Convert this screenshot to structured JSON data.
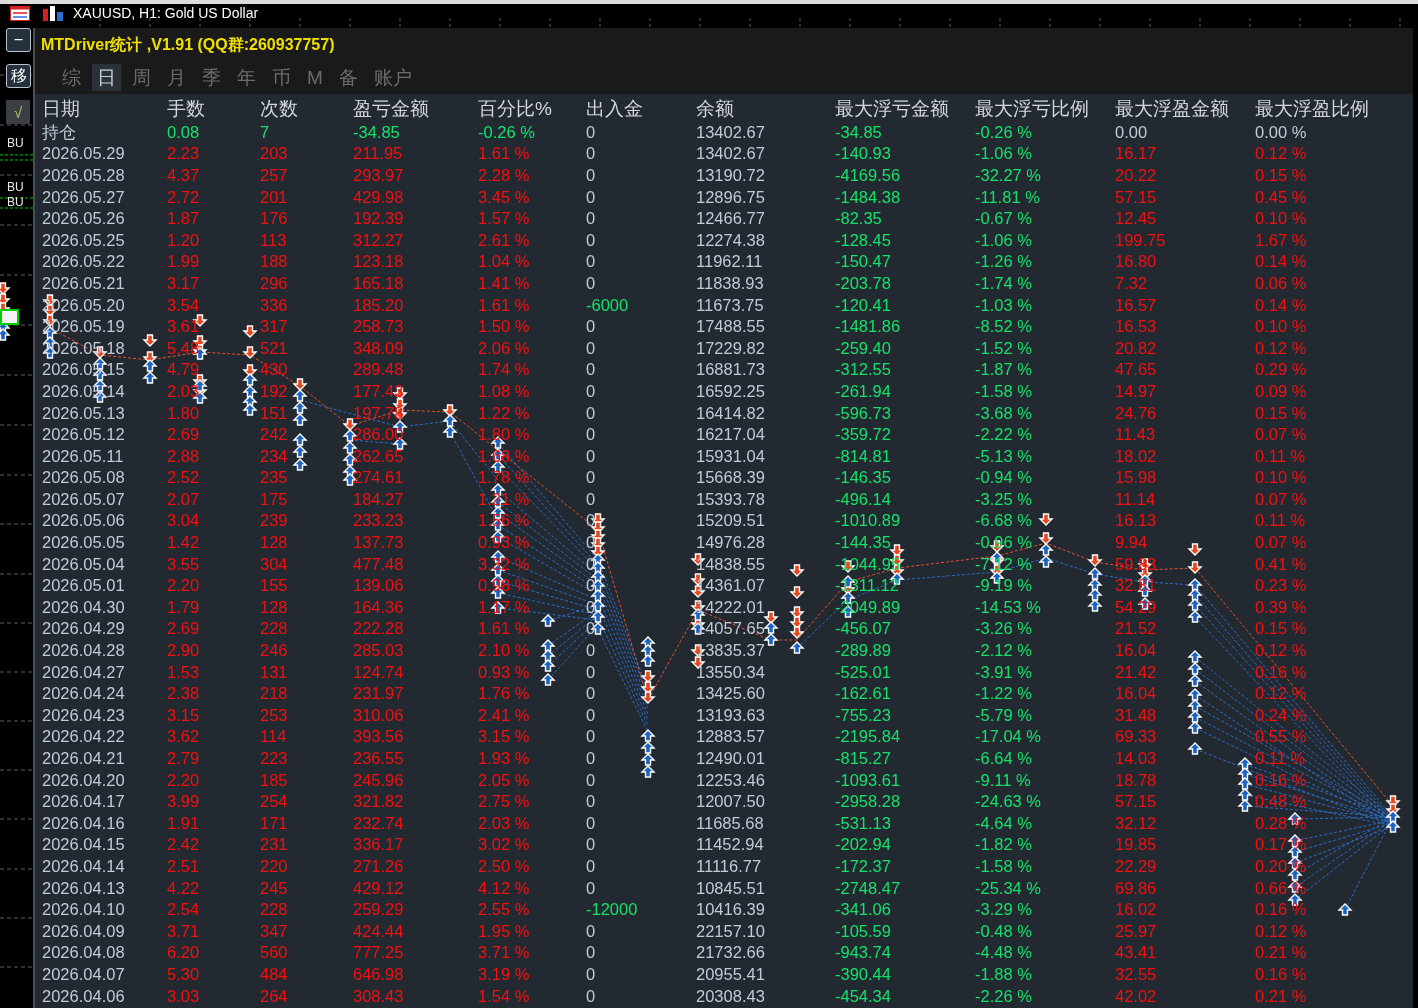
{
  "chart": {
    "title": "XAUUSD, H1: Gold US Dollar",
    "side_buttons": [
      {
        "label": "−",
        "kind": "boxed"
      },
      {
        "label": "移",
        "kind": "boxed"
      },
      {
        "label": "√",
        "kind": "solid"
      }
    ],
    "order_labels": [
      "BU",
      "BU",
      "BU"
    ]
  },
  "panel": {
    "title": "MTDriver统计 ,V1.91 (QQ群:260937757)",
    "tabs": [
      {
        "label": "综",
        "selected": false
      },
      {
        "label": "日",
        "selected": true
      },
      {
        "label": "周",
        "selected": false
      },
      {
        "label": "月",
        "selected": false
      },
      {
        "label": "季",
        "selected": false
      },
      {
        "label": "年",
        "selected": false
      },
      {
        "label": "币",
        "selected": false
      },
      {
        "label": "M",
        "selected": false
      },
      {
        "label": "备",
        "selected": false
      },
      {
        "label": "账户",
        "selected": false
      }
    ]
  },
  "table": {
    "columns": [
      "日期",
      "手数",
      "次数",
      "盈亏金额",
      "百分比%",
      "出入金",
      "余额",
      "最大浮亏金额",
      "最大浮亏比例",
      "最大浮盈金额",
      "最大浮盈比例"
    ],
    "rows": [
      {
        "date": "持仓",
        "lots": "0.08",
        "trades": "7",
        "pnl": "-34.85",
        "pnl_pct": "-0.26 %",
        "transfer": "0",
        "balance": "13402.67",
        "max_float_loss": "-34.85",
        "max_float_loss_pct": "-0.26 %",
        "max_float_profit": "0.00",
        "max_float_profit_pct": "0.00 %",
        "in_profit": false,
        "transfer_negative": false,
        "float_profit_positive": false
      },
      {
        "date": "2026.05.29",
        "lots": "2.23",
        "trades": "203",
        "pnl": "211.95",
        "pnl_pct": "1.61 %",
        "transfer": "0",
        "balance": "13402.67",
        "max_float_loss": "-140.93",
        "max_float_loss_pct": "-1.06 %",
        "max_float_profit": "16.17",
        "max_float_profit_pct": "0.12 %",
        "in_profit": true,
        "transfer_negative": false,
        "float_profit_positive": true
      },
      {
        "date": "2026.05.28",
        "lots": "4.37",
        "trades": "257",
        "pnl": "293.97",
        "pnl_pct": "2.28 %",
        "transfer": "0",
        "balance": "13190.72",
        "max_float_loss": "-4169.56",
        "max_float_loss_pct": "-32.27 %",
        "max_float_profit": "20.22",
        "max_float_profit_pct": "0.15 %",
        "in_profit": true,
        "transfer_negative": false,
        "float_profit_positive": true
      },
      {
        "date": "2026.05.27",
        "lots": "2.72",
        "trades": "201",
        "pnl": "429.98",
        "pnl_pct": "3.45 %",
        "transfer": "0",
        "balance": "12896.75",
        "max_float_loss": "-1484.38",
        "max_float_loss_pct": "-11.81 %",
        "max_float_profit": "57.15",
        "max_float_profit_pct": "0.45 %",
        "in_profit": true,
        "transfer_negative": false,
        "float_profit_positive": true
      },
      {
        "date": "2026.05.26",
        "lots": "1.87",
        "trades": "176",
        "pnl": "192.39",
        "pnl_pct": "1.57 %",
        "transfer": "0",
        "balance": "12466.77",
        "max_float_loss": "-82.35",
        "max_float_loss_pct": "-0.67 %",
        "max_float_profit": "12.45",
        "max_float_profit_pct": "0.10 %",
        "in_profit": true,
        "transfer_negative": false,
        "float_profit_positive": true
      },
      {
        "date": "2026.05.25",
        "lots": "1.20",
        "trades": "113",
        "pnl": "312.27",
        "pnl_pct": "2.61 %",
        "transfer": "0",
        "balance": "12274.38",
        "max_float_loss": "-128.45",
        "max_float_loss_pct": "-1.06 %",
        "max_float_profit": "199.75",
        "max_float_profit_pct": "1.67 %",
        "in_profit": true,
        "transfer_negative": false,
        "float_profit_positive": true
      },
      {
        "date": "2026.05.22",
        "lots": "1.99",
        "trades": "188",
        "pnl": "123.18",
        "pnl_pct": "1.04 %",
        "transfer": "0",
        "balance": "11962.11",
        "max_float_loss": "-150.47",
        "max_float_loss_pct": "-1.26 %",
        "max_float_profit": "16.80",
        "max_float_profit_pct": "0.14 %",
        "in_profit": true,
        "transfer_negative": false,
        "float_profit_positive": true
      },
      {
        "date": "2026.05.21",
        "lots": "3.17",
        "trades": "296",
        "pnl": "165.18",
        "pnl_pct": "1.41 %",
        "transfer": "0",
        "balance": "11838.93",
        "max_float_loss": "-203.78",
        "max_float_loss_pct": "-1.74 %",
        "max_float_profit": "7.32",
        "max_float_profit_pct": "0.06 %",
        "in_profit": true,
        "transfer_negative": false,
        "float_profit_positive": true
      },
      {
        "date": "2026.05.20",
        "lots": "3.54",
        "trades": "336",
        "pnl": "185.20",
        "pnl_pct": "1.61 %",
        "transfer": "-6000",
        "balance": "11673.75",
        "max_float_loss": "-120.41",
        "max_float_loss_pct": "-1.03 %",
        "max_float_profit": "16.57",
        "max_float_profit_pct": "0.14 %",
        "in_profit": true,
        "transfer_negative": true,
        "float_profit_positive": true
      },
      {
        "date": "2026.05.19",
        "lots": "3.61",
        "trades": "317",
        "pnl": "258.73",
        "pnl_pct": "1.50 %",
        "transfer": "0",
        "balance": "17488.55",
        "max_float_loss": "-1481.86",
        "max_float_loss_pct": "-8.52 %",
        "max_float_profit": "16.53",
        "max_float_profit_pct": "0.10 %",
        "in_profit": true,
        "transfer_negative": false,
        "float_profit_positive": true
      },
      {
        "date": "2026.05.18",
        "lots": "5.48",
        "trades": "521",
        "pnl": "348.09",
        "pnl_pct": "2.06 %",
        "transfer": "0",
        "balance": "17229.82",
        "max_float_loss": "-259.40",
        "max_float_loss_pct": "-1.52 %",
        "max_float_profit": "20.82",
        "max_float_profit_pct": "0.12 %",
        "in_profit": true,
        "transfer_negative": false,
        "float_profit_positive": true
      },
      {
        "date": "2026.05.15",
        "lots": "4.79",
        "trades": "430",
        "pnl": "289.48",
        "pnl_pct": "1.74 %",
        "transfer": "0",
        "balance": "16881.73",
        "max_float_loss": "-312.55",
        "max_float_loss_pct": "-1.87 %",
        "max_float_profit": "47.65",
        "max_float_profit_pct": "0.29 %",
        "in_profit": true,
        "transfer_negative": false,
        "float_profit_positive": true
      },
      {
        "date": "2026.05.14",
        "lots": "2.03",
        "trades": "192",
        "pnl": "177.43",
        "pnl_pct": "1.08 %",
        "transfer": "0",
        "balance": "16592.25",
        "max_float_loss": "-261.94",
        "max_float_loss_pct": "-1.58 %",
        "max_float_profit": "14.97",
        "max_float_profit_pct": "0.09 %",
        "in_profit": true,
        "transfer_negative": false,
        "float_profit_positive": true
      },
      {
        "date": "2026.05.13",
        "lots": "1.80",
        "trades": "151",
        "pnl": "197.78",
        "pnl_pct": "1.22 %",
        "transfer": "0",
        "balance": "16414.82",
        "max_float_loss": "-596.73",
        "max_float_loss_pct": "-3.68 %",
        "max_float_profit": "24.76",
        "max_float_profit_pct": "0.15 %",
        "in_profit": true,
        "transfer_negative": false,
        "float_profit_positive": true
      },
      {
        "date": "2026.05.12",
        "lots": "2.69",
        "trades": "242",
        "pnl": "286.00",
        "pnl_pct": "1.80 %",
        "transfer": "0",
        "balance": "16217.04",
        "max_float_loss": "-359.72",
        "max_float_loss_pct": "-2.22 %",
        "max_float_profit": "11.43",
        "max_float_profit_pct": "0.07 %",
        "in_profit": true,
        "transfer_negative": false,
        "float_profit_positive": true
      },
      {
        "date": "2026.05.11",
        "lots": "2.88",
        "trades": "234",
        "pnl": "262.65",
        "pnl_pct": "1.68 %",
        "transfer": "0",
        "balance": "15931.04",
        "max_float_loss": "-814.81",
        "max_float_loss_pct": "-5.13 %",
        "max_float_profit": "18.02",
        "max_float_profit_pct": "0.11 %",
        "in_profit": true,
        "transfer_negative": false,
        "float_profit_positive": true
      },
      {
        "date": "2026.05.08",
        "lots": "2.52",
        "trades": "235",
        "pnl": "274.61",
        "pnl_pct": "1.78 %",
        "transfer": "0",
        "balance": "15668.39",
        "max_float_loss": "-146.35",
        "max_float_loss_pct": "-0.94 %",
        "max_float_profit": "15.98",
        "max_float_profit_pct": "0.10 %",
        "in_profit": true,
        "transfer_negative": false,
        "float_profit_positive": true
      },
      {
        "date": "2026.05.07",
        "lots": "2.07",
        "trades": "175",
        "pnl": "184.27",
        "pnl_pct": "1.21 %",
        "transfer": "0",
        "balance": "15393.78",
        "max_float_loss": "-496.14",
        "max_float_loss_pct": "-3.25 %",
        "max_float_profit": "11.14",
        "max_float_profit_pct": "0.07 %",
        "in_profit": true,
        "transfer_negative": false,
        "float_profit_positive": true
      },
      {
        "date": "2026.05.06",
        "lots": "3.04",
        "trades": "239",
        "pnl": "233.23",
        "pnl_pct": "1.56 %",
        "transfer": "0",
        "balance": "15209.51",
        "max_float_loss": "-1010.89",
        "max_float_loss_pct": "-6.68 %",
        "max_float_profit": "16.13",
        "max_float_profit_pct": "0.11 %",
        "in_profit": true,
        "transfer_negative": false,
        "float_profit_positive": true
      },
      {
        "date": "2026.05.05",
        "lots": "1.42",
        "trades": "128",
        "pnl": "137.73",
        "pnl_pct": "0.93 %",
        "transfer": "0",
        "balance": "14976.28",
        "max_float_loss": "-144.35",
        "max_float_loss_pct": "-0.96 %",
        "max_float_profit": "9.94",
        "max_float_profit_pct": "0.07 %",
        "in_profit": true,
        "transfer_negative": false,
        "float_profit_positive": true
      },
      {
        "date": "2026.05.04",
        "lots": "3.55",
        "trades": "304",
        "pnl": "477.48",
        "pnl_pct": "3.32 %",
        "transfer": "0",
        "balance": "14838.55",
        "max_float_loss": "-1044.95",
        "max_float_loss_pct": "-7.12 %",
        "max_float_profit": "59.83",
        "max_float_profit_pct": "0.41 %",
        "in_profit": true,
        "transfer_negative": false,
        "float_profit_positive": true
      },
      {
        "date": "2026.05.01",
        "lots": "2.20",
        "trades": "155",
        "pnl": "139.06",
        "pnl_pct": "0.98 %",
        "transfer": "0",
        "balance": "14361.07",
        "max_float_loss": "-1311.12",
        "max_float_loss_pct": "-9.19 %",
        "max_float_profit": "32.81",
        "max_float_profit_pct": "0.23 %",
        "in_profit": true,
        "transfer_negative": false,
        "float_profit_positive": true
      },
      {
        "date": "2026.04.30",
        "lots": "1.79",
        "trades": "128",
        "pnl": "164.36",
        "pnl_pct": "1.17 %",
        "transfer": "0",
        "balance": "14222.01",
        "max_float_loss": "-2049.89",
        "max_float_loss_pct": "-14.53 %",
        "max_float_profit": "54.29",
        "max_float_profit_pct": "0.39 %",
        "in_profit": true,
        "transfer_negative": false,
        "float_profit_positive": true
      },
      {
        "date": "2026.04.29",
        "lots": "2.69",
        "trades": "228",
        "pnl": "222.28",
        "pnl_pct": "1.61 %",
        "transfer": "0",
        "balance": "14057.65",
        "max_float_loss": "-456.07",
        "max_float_loss_pct": "-3.26 %",
        "max_float_profit": "21.52",
        "max_float_profit_pct": "0.15 %",
        "in_profit": true,
        "transfer_negative": false,
        "float_profit_positive": true
      },
      {
        "date": "2026.04.28",
        "lots": "2.90",
        "trades": "246",
        "pnl": "285.03",
        "pnl_pct": "2.10 %",
        "transfer": "0",
        "balance": "13835.37",
        "max_float_loss": "-289.89",
        "max_float_loss_pct": "-2.12 %",
        "max_float_profit": "16.04",
        "max_float_profit_pct": "0.12 %",
        "in_profit": true,
        "transfer_negative": false,
        "float_profit_positive": true
      },
      {
        "date": "2026.04.27",
        "lots": "1.53",
        "trades": "131",
        "pnl": "124.74",
        "pnl_pct": "0.93 %",
        "transfer": "0",
        "balance": "13550.34",
        "max_float_loss": "-525.01",
        "max_float_loss_pct": "-3.91 %",
        "max_float_profit": "21.42",
        "max_float_profit_pct": "0.16 %",
        "in_profit": true,
        "transfer_negative": false,
        "float_profit_positive": true
      },
      {
        "date": "2026.04.24",
        "lots": "2.38",
        "trades": "218",
        "pnl": "231.97",
        "pnl_pct": "1.76 %",
        "transfer": "0",
        "balance": "13425.60",
        "max_float_loss": "-162.61",
        "max_float_loss_pct": "-1.22 %",
        "max_float_profit": "16.04",
        "max_float_profit_pct": "0.12 %",
        "in_profit": true,
        "transfer_negative": false,
        "float_profit_positive": true
      },
      {
        "date": "2026.04.23",
        "lots": "3.15",
        "trades": "253",
        "pnl": "310.06",
        "pnl_pct": "2.41 %",
        "transfer": "0",
        "balance": "13193.63",
        "max_float_loss": "-755.23",
        "max_float_loss_pct": "-5.79 %",
        "max_float_profit": "31.48",
        "max_float_profit_pct": "0.24 %",
        "in_profit": true,
        "transfer_negative": false,
        "float_profit_positive": true
      },
      {
        "date": "2026.04.22",
        "lots": "3.62",
        "trades": "114",
        "pnl": "393.56",
        "pnl_pct": "3.15 %",
        "transfer": "0",
        "balance": "12883.57",
        "max_float_loss": "-2195.84",
        "max_float_loss_pct": "-17.04 %",
        "max_float_profit": "69.33",
        "max_float_profit_pct": "0.55 %",
        "in_profit": true,
        "transfer_negative": false,
        "float_profit_positive": true
      },
      {
        "date": "2026.04.21",
        "lots": "2.79",
        "trades": "223",
        "pnl": "236.55",
        "pnl_pct": "1.93 %",
        "transfer": "0",
        "balance": "12490.01",
        "max_float_loss": "-815.27",
        "max_float_loss_pct": "-6.64 %",
        "max_float_profit": "14.03",
        "max_float_profit_pct": "0.11 %",
        "in_profit": true,
        "transfer_negative": false,
        "float_profit_positive": true
      },
      {
        "date": "2026.04.20",
        "lots": "2.20",
        "trades": "185",
        "pnl": "245.96",
        "pnl_pct": "2.05 %",
        "transfer": "0",
        "balance": "12253.46",
        "max_float_loss": "-1093.61",
        "max_float_loss_pct": "-9.11 %",
        "max_float_profit": "18.78",
        "max_float_profit_pct": "0.16 %",
        "in_profit": true,
        "transfer_negative": false,
        "float_profit_positive": true
      },
      {
        "date": "2026.04.17",
        "lots": "3.99",
        "trades": "254",
        "pnl": "321.82",
        "pnl_pct": "2.75 %",
        "transfer": "0",
        "balance": "12007.50",
        "max_float_loss": "-2958.28",
        "max_float_loss_pct": "-24.63 %",
        "max_float_profit": "57.15",
        "max_float_profit_pct": "0.48 %",
        "in_profit": true,
        "transfer_negative": false,
        "float_profit_positive": true
      },
      {
        "date": "2026.04.16",
        "lots": "1.91",
        "trades": "171",
        "pnl": "232.74",
        "pnl_pct": "2.03 %",
        "transfer": "0",
        "balance": "11685.68",
        "max_float_loss": "-531.13",
        "max_float_loss_pct": "-4.64 %",
        "max_float_profit": "32.12",
        "max_float_profit_pct": "0.28 %",
        "in_profit": true,
        "transfer_negative": false,
        "float_profit_positive": true
      },
      {
        "date": "2026.04.15",
        "lots": "2.42",
        "trades": "231",
        "pnl": "336.17",
        "pnl_pct": "3.02 %",
        "transfer": "0",
        "balance": "11452.94",
        "max_float_loss": "-202.94",
        "max_float_loss_pct": "-1.82 %",
        "max_float_profit": "19.85",
        "max_float_profit_pct": "0.17 %",
        "in_profit": true,
        "transfer_negative": false,
        "float_profit_positive": true
      },
      {
        "date": "2026.04.14",
        "lots": "2.51",
        "trades": "220",
        "pnl": "271.26",
        "pnl_pct": "2.50 %",
        "transfer": "0",
        "balance": "11116.77",
        "max_float_loss": "-172.37",
        "max_float_loss_pct": "-1.58 %",
        "max_float_profit": "22.29",
        "max_float_profit_pct": "0.20 %",
        "in_profit": true,
        "transfer_negative": false,
        "float_profit_positive": true
      },
      {
        "date": "2026.04.13",
        "lots": "4.22",
        "trades": "245",
        "pnl": "429.12",
        "pnl_pct": "4.12 %",
        "transfer": "0",
        "balance": "10845.51",
        "max_float_loss": "-2748.47",
        "max_float_loss_pct": "-25.34 %",
        "max_float_profit": "69.86",
        "max_float_profit_pct": "0.66 %",
        "in_profit": true,
        "transfer_negative": false,
        "float_profit_positive": true
      },
      {
        "date": "2026.04.10",
        "lots": "2.54",
        "trades": "228",
        "pnl": "259.29",
        "pnl_pct": "2.55 %",
        "transfer": "-12000",
        "balance": "10416.39",
        "max_float_loss": "-341.06",
        "max_float_loss_pct": "-3.29 %",
        "max_float_profit": "16.02",
        "max_float_profit_pct": "0.16 %",
        "in_profit": true,
        "transfer_negative": true,
        "float_profit_positive": true
      },
      {
        "date": "2026.04.09",
        "lots": "3.71",
        "trades": "347",
        "pnl": "424.44",
        "pnl_pct": "1.95 %",
        "transfer": "0",
        "balance": "22157.10",
        "max_float_loss": "-105.59",
        "max_float_loss_pct": "-0.48 %",
        "max_float_profit": "25.97",
        "max_float_profit_pct": "0.12 %",
        "in_profit": true,
        "transfer_negative": false,
        "float_profit_positive": true
      },
      {
        "date": "2026.04.08",
        "lots": "6.20",
        "trades": "560",
        "pnl": "777.25",
        "pnl_pct": "3.71 %",
        "transfer": "0",
        "balance": "21732.66",
        "max_float_loss": "-943.74",
        "max_float_loss_pct": "-4.48 %",
        "max_float_profit": "43.41",
        "max_float_profit_pct": "0.21 %",
        "in_profit": true,
        "transfer_negative": false,
        "float_profit_positive": true
      },
      {
        "date": "2026.04.07",
        "lots": "5.30",
        "trades": "484",
        "pnl": "646.98",
        "pnl_pct": "3.19 %",
        "transfer": "0",
        "balance": "20955.41",
        "max_float_loss": "-390.44",
        "max_float_loss_pct": "-1.88 %",
        "max_float_profit": "32.55",
        "max_float_profit_pct": "0.16 %",
        "in_profit": true,
        "transfer_negative": false,
        "float_profit_positive": true
      },
      {
        "date": "2026.04.06",
        "lots": "3.03",
        "trades": "264",
        "pnl": "308.43",
        "pnl_pct": "1.54 %",
        "transfer": "0",
        "balance": "20308.43",
        "max_float_loss": "-454.34",
        "max_float_loss_pct": "-2.26 %",
        "max_float_profit": "42.02",
        "max_float_profit_pct": "0.21 %",
        "in_profit": true,
        "transfer_negative": false,
        "float_profit_positive": true
      }
    ]
  }
}
